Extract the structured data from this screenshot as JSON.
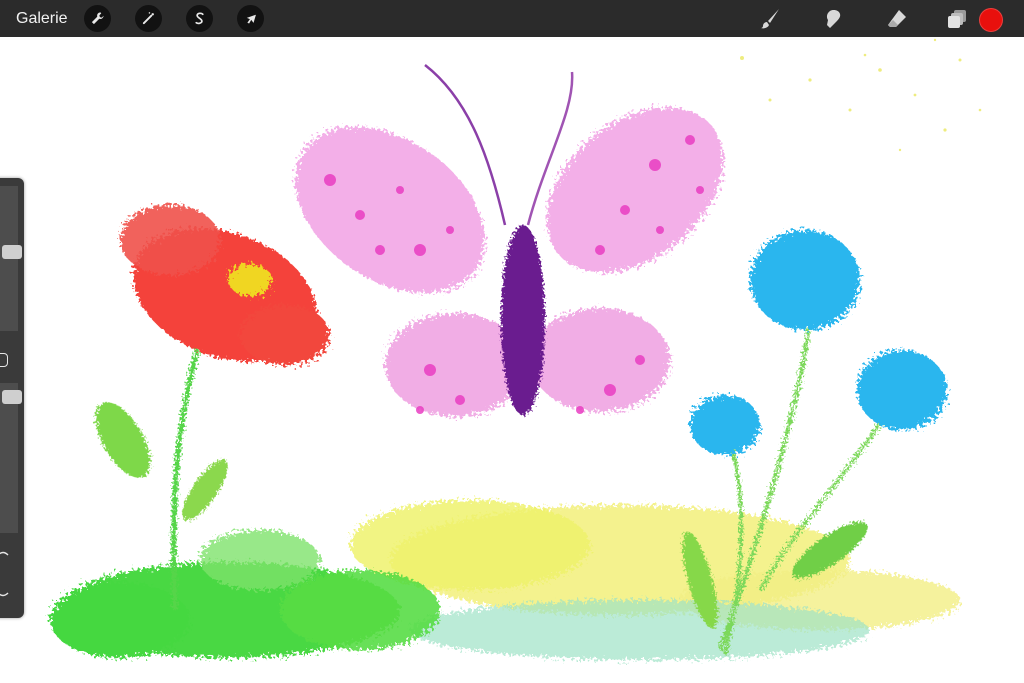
{
  "topbar": {
    "gallery_label": "Galerie",
    "left_tools": [
      "wrench-icon",
      "magic-wand-icon",
      "selection-s-icon",
      "arrow-cursor-icon"
    ],
    "right_tools": [
      "brush-icon",
      "smudge-icon",
      "eraser-icon",
      "layers-icon"
    ],
    "current_color": "#e8100d"
  },
  "canvas": {
    "background": "#ffffff",
    "artwork": "flowers-and-butterfly-painting"
  },
  "sidebar": {
    "brush_size_level": 0.55,
    "opacity_level": 0.95
  }
}
